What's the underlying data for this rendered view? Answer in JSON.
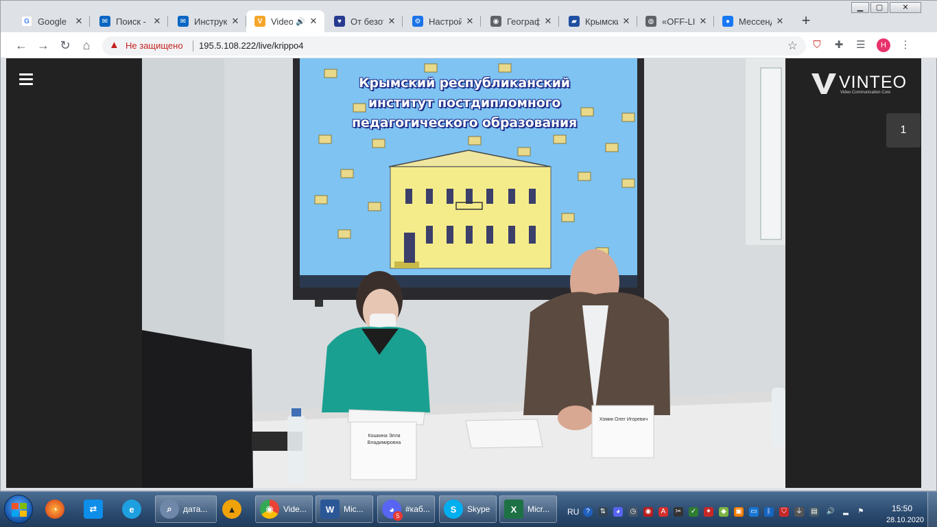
{
  "browser": {
    "tabs": [
      {
        "title": "Google",
        "favicon": "google-icon",
        "color": "#4285f4",
        "glyph": "G"
      },
      {
        "title": "Поиск - Почта",
        "favicon": "mail-icon",
        "color": "#0a66c2",
        "glyph": "✉"
      },
      {
        "title": "Инструкции",
        "favicon": "mail-icon",
        "color": "#0a66c2",
        "glyph": "✉"
      },
      {
        "title": "Video",
        "favicon": "vinteo-icon",
        "color": "#f4a62a",
        "glyph": "V",
        "active": true,
        "audio": true
      },
      {
        "title": "От безотказ",
        "favicon": "heart-icon",
        "color": "#263b8f",
        "glyph": "♥"
      },
      {
        "title": "Настройки",
        "favicon": "gear-icon",
        "color": "#1a73e8",
        "glyph": "⚙"
      },
      {
        "title": "Географ",
        "favicon": "eye-icon",
        "color": "#5f6368",
        "glyph": "◉"
      },
      {
        "title": "Крымский",
        "favicon": "book-icon",
        "color": "#1f4fa0",
        "glyph": "▰"
      },
      {
        "title": "«OFF-LINE",
        "favicon": "globe-icon",
        "color": "#5f6368",
        "glyph": "◍"
      },
      {
        "title": "Мессенджер",
        "favicon": "messenger-icon",
        "color": "#1877f2",
        "glyph": "●"
      }
    ],
    "new_tab": "+",
    "address": {
      "security_label": "Не защищено",
      "url": "195.5.108.222/live/krippo4"
    },
    "profile_initial": "Н"
  },
  "video": {
    "screen_title": "Крымский республиканский институт постдипломного педагогического образования",
    "nameplate_left": "Кошкина Элла Владимировна",
    "nameplate_right": "Хомик Олег Игоревич"
  },
  "vinteo": {
    "brand": "VINTEO",
    "tagline": "Video Communication Core",
    "participant_count": "1"
  },
  "taskbar": {
    "items": [
      {
        "label": "дата...",
        "icon": "search-icon",
        "color": "#6f87a8",
        "glyph": "🔍"
      },
      {
        "label": "Vide...",
        "icon": "chrome-icon",
        "color": "#e8453c",
        "glyph": "◉"
      },
      {
        "label": "Mic...",
        "icon": "word-icon",
        "color": "#2b5797",
        "glyph": "W"
      },
      {
        "label": "#каб...",
        "icon": "discord-icon",
        "color": "#5865f2",
        "glyph": "◕",
        "badge": "5"
      },
      {
        "label": "Skype",
        "icon": "skype-icon",
        "color": "#00aff0",
        "glyph": "S"
      },
      {
        "label": "Micr...",
        "icon": "excel-icon",
        "color": "#1e7145",
        "glyph": "X"
      }
    ],
    "language": "RU",
    "time": "15:50",
    "date": "28.10.2020"
  },
  "colors": {
    "chrome_frame": "#dee1e6",
    "insecure_red": "#c5221f",
    "page_bg": "#222222",
    "screen_blue": "#7ec3f2",
    "building_yellow": "#f4ec8a"
  }
}
